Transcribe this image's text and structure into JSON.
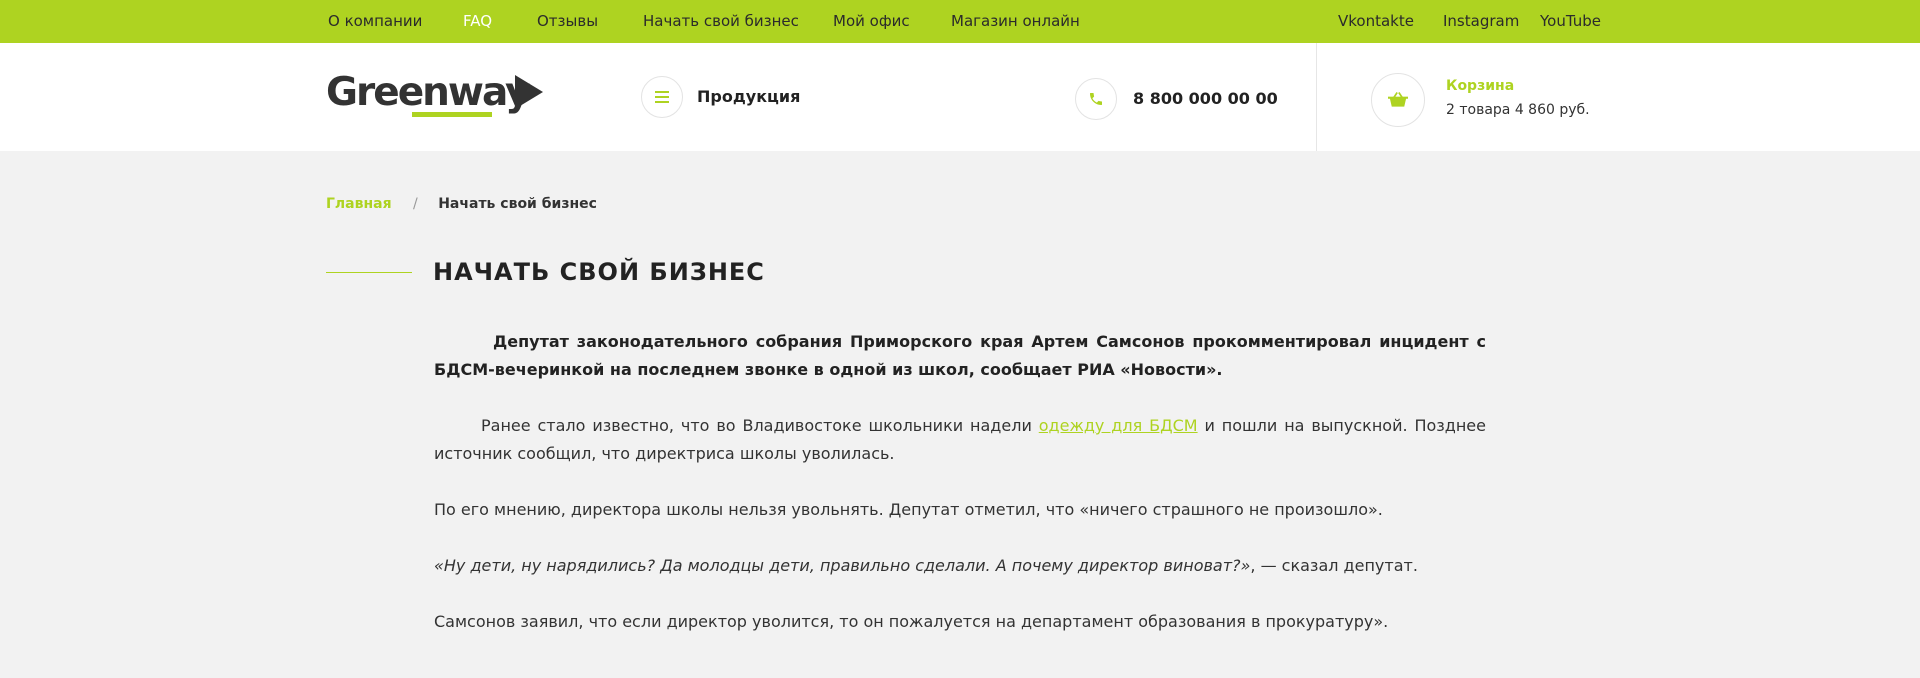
{
  "topnav": {
    "items": [
      {
        "label": "О компании"
      },
      {
        "label": "FAQ"
      },
      {
        "label": "Отзывы"
      },
      {
        "label": "Начать свой бизнес"
      },
      {
        "label": "Мой офис"
      },
      {
        "label": "Магазин онлайн"
      }
    ],
    "social": [
      {
        "label": "Vkontakte"
      },
      {
        "label": "Instagram"
      },
      {
        "label": "YouTube"
      }
    ]
  },
  "header": {
    "logo_text": "Greenway",
    "menu_icon": "hamburger-icon",
    "products_label": "Продукция",
    "phone_icon": "phone-icon",
    "phone": "8 800 000 00 00",
    "cart_icon": "basket-icon",
    "cart_title": "Корзина",
    "cart_info": "2 товара  4 860 руб."
  },
  "breadcrumb": {
    "home": "Главная",
    "separator": "/",
    "current": "Начать свой бизнес"
  },
  "page": {
    "title": "НАЧАТЬ СВОЙ БИЗНЕС"
  },
  "article": {
    "lead": "Депутат законодательного собрания Приморского края Артем Самсонов прокомментировал инцидент с БДСМ-вечеринкой на последнем звонке в одной из школ, сообщает РИА «Новости».",
    "p2_before": "Ранее стало известно, что во Владивостоке школьники надели ",
    "p2_link": "одежду для БДСМ",
    "p2_after": " и пошли на выпускной. Позднее источник сообщил, что директриса школы уволилась.",
    "p3": "По его мнению, директора школы нельзя увольнять. Депутат отметил, что «ничего страшного не произошло».",
    "p4_quote": "«Ну дети, ну нарядились? Да молодцы дети, правильно сделали. А почему директор виноват?»",
    "p4_after": ", — сказал депутат.",
    "p5": "Самсонов заявил, что если директор уволится, то он пожалуется на департамент образования в прокуратуру»."
  },
  "colors": {
    "accent": "#aed321",
    "background": "#f2f2f2",
    "header_bg": "#ffffff",
    "text": "#222222"
  }
}
